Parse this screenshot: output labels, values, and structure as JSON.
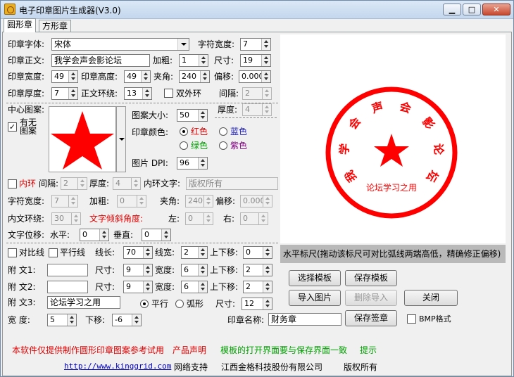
{
  "window": {
    "title": "电子印章图片生成器(V3.0)",
    "min": "▁",
    "max": "□",
    "close": "✕"
  },
  "tabs": [
    {
      "label": "圆形章",
      "active": true
    },
    {
      "label": "方形章",
      "active": false
    }
  ],
  "form": {
    "font_label": "印章字体:",
    "font_value": "宋体",
    "char_width_label": "字符宽度:",
    "char_width_value": "7",
    "text_label": "印章正文:",
    "text_value": "我学会声会影论坛",
    "bold_label": "加粗:",
    "bold_value": "1",
    "size_label": "尺寸:",
    "size_value": "19",
    "width_label": "印章宽度:",
    "width_value": "49",
    "height_label": "印章高度:",
    "height_value": "49",
    "angle_label": "夹角:",
    "angle_value": "240",
    "offset_label": "偏移:",
    "offset_value": "0.000",
    "thick_label": "印章厚度:",
    "thick_value": "7",
    "ring_label": "正文环绕:",
    "ring_value": "13",
    "double_ring_label": "双外环",
    "gap_label": "间隔:",
    "gap_value": "2",
    "thick2_label": "厚度:",
    "thick2_value": "4",
    "center_label": "中心图案:",
    "hasnone_label": "有无图案",
    "pattern_size_label": "图案大小:",
    "pattern_size_value": "50",
    "color_label": "印章颜色:",
    "colors": {
      "red": "红色",
      "blue": "蓝色",
      "green": "绿色",
      "purple": "紫色"
    },
    "dpi_label": "图片 DPI:",
    "dpi_value": "96",
    "inner_ring_label": "内环",
    "inner_gap_label": "间隔:",
    "inner_gap_value": "2",
    "inner_thick_label": "厚度:",
    "inner_thick_value": "4",
    "inner_text_label": "内环文字:",
    "inner_text_value": "版权所有",
    "char_width2_label": "字符宽度:",
    "char_width2_value": "7",
    "bold2_label": "加粗:",
    "bold2_value": "0",
    "angle2_label": "夹角:",
    "angle2_value": "240",
    "offset2_label": "偏移:",
    "offset2_value": "0.000",
    "inner_ring2_label": "内文环绕:",
    "inner_ring2_value": "30",
    "tilt_label": "文字倾斜角度:",
    "left_label": "左:",
    "left_value": "0",
    "right_label": "右:",
    "right_value": "0",
    "pos_label": "文字位移:",
    "h_label": "水平:",
    "h_value": "0",
    "v_label": "垂直:",
    "v_value": "0",
    "compare_label": "对比线",
    "parallel_label": "平行线",
    "linelen_label": "线长:",
    "linelen_value": "70",
    "linew_label": "线宽:",
    "linew_value": "2",
    "updown_label": "上下移:",
    "updown_value": "0",
    "a1_label": "附  文1:",
    "a1_value": "",
    "a1_size_label": "尺寸:",
    "a1_size_value": "9",
    "a1_w_label": "宽度:",
    "a1_w_value": "6",
    "a1_ud_label": "上下移:",
    "a1_ud_value": "2",
    "a2_label": "附  文2:",
    "a2_value": "",
    "a2_size_label": "尺寸:",
    "a2_size_value": "9",
    "a2_w_label": "宽度:",
    "a2_w_value": "6",
    "a2_ud_label": "上下移:",
    "a2_ud_value": "2",
    "a3_label": "附  文3:",
    "a3_value": "论坛学习之用",
    "flat_label": "平行",
    "arc_label": "弧形",
    "a3_size_label": "尺寸:",
    "a3_size_value": "12",
    "w_label": "宽   度:",
    "w_value": "5",
    "down_label": "下移:",
    "down_value": "-6",
    "stamp_name_label": "印章名称:",
    "stamp_name_value": "财务章",
    "bmp_label": "BMP格式"
  },
  "preview": {
    "ring_text": [
      "我",
      "学",
      "会",
      "声",
      "会",
      "影",
      "论",
      "坛"
    ],
    "bottom_text": "论坛学习之用",
    "stamp_color": "#ff0000"
  },
  "hint": "水平标尺(拖动该标尺可对比弧线两端高低，精确修正偏移)",
  "buttons": {
    "choose_template": "选择模板",
    "save_template": "保存模板",
    "import_image": "导入图片",
    "delete_import": "删除导入",
    "close": "关闭",
    "save_stamp": "保存签章"
  },
  "footer": {
    "notice": "本软件仅提供制作圆形印章图案参考试用",
    "declare": "产品声明",
    "tip_text": "模板的打开界面要与保存界面一致",
    "tip": "提示",
    "url": "http://www.kinggrid.com",
    "support": "网络支持",
    "company": "江西金格科技股份有限公司",
    "rights": "版权所有"
  }
}
